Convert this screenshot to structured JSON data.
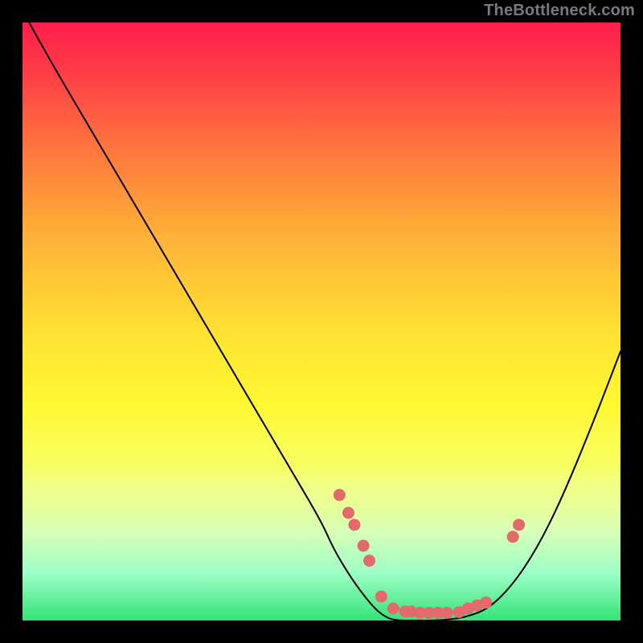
{
  "watermark": "TheBottleneck.com",
  "colors": {
    "page_bg": "#000000",
    "point_fill": "#e26a6a",
    "curve_stroke": "#000000"
  },
  "chart_data": {
    "type": "line",
    "title": "",
    "xlabel": "",
    "ylabel": "",
    "xlim": [
      0,
      100
    ],
    "ylim": [
      0,
      100
    ],
    "series": [
      {
        "name": "curve",
        "x": [
          0,
          5,
          10,
          15,
          20,
          25,
          30,
          35,
          40,
          45,
          50,
          52,
          55,
          58,
          60,
          62,
          66,
          70,
          74,
          78,
          82,
          86,
          90,
          95,
          100
        ],
        "y": [
          102,
          93,
          84.5,
          76,
          67.5,
          59,
          50.5,
          42,
          33.5,
          25,
          16.5,
          12,
          7,
          3,
          1,
          0,
          0,
          0,
          0.5,
          2,
          6,
          12,
          20,
          32,
          45
        ]
      }
    ],
    "points": [
      {
        "x": 53,
        "y": 21
      },
      {
        "x": 54.5,
        "y": 18
      },
      {
        "x": 55.5,
        "y": 16
      },
      {
        "x": 57,
        "y": 12.5
      },
      {
        "x": 58,
        "y": 10
      },
      {
        "x": 60,
        "y": 4
      },
      {
        "x": 62,
        "y": 2
      },
      {
        "x": 64,
        "y": 1.5
      },
      {
        "x": 65,
        "y": 1.5
      },
      {
        "x": 66.5,
        "y": 1.3
      },
      {
        "x": 68,
        "y": 1.3
      },
      {
        "x": 69.5,
        "y": 1.3
      },
      {
        "x": 71,
        "y": 1.3
      },
      {
        "x": 73,
        "y": 1.4
      },
      {
        "x": 74.5,
        "y": 2
      },
      {
        "x": 76,
        "y": 2.5
      },
      {
        "x": 77.5,
        "y": 3
      },
      {
        "x": 82,
        "y": 14
      },
      {
        "x": 83,
        "y": 16
      }
    ]
  }
}
